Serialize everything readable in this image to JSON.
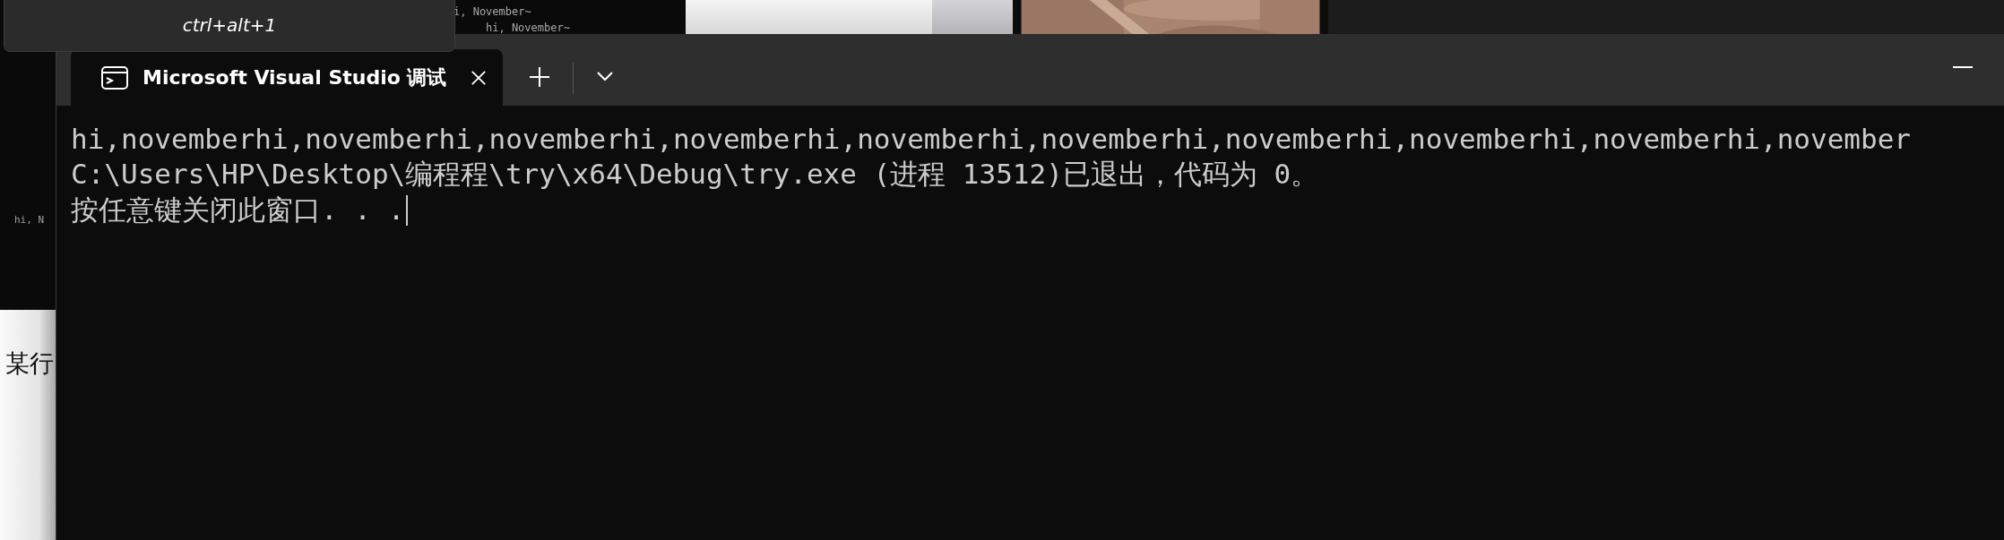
{
  "background": {
    "editor_lines": [
      "i, November~",
      "hi, November~"
    ],
    "side_text": "hi, N",
    "doc_text": "某行",
    "photo": {
      "kind": "picture"
    }
  },
  "tooltip": {
    "shortcut": "ctrl+alt+1"
  },
  "terminal": {
    "tabs": [
      {
        "title": "Microsoft Visual Studio 调试",
        "selected": true
      }
    ],
    "lines": [
      "hi,novemberhi,novemberhi,novemberhi,novemberhi,novemberhi,novemberhi,novemberhi,novemberhi,novemberhi,november",
      "C:\\Users\\HP\\Desktop\\编程程\\try\\x64\\Debug\\try.exe (进程 13512)已退出，代码为 0。",
      "按任意键关闭此窗口. . ."
    ],
    "cursor": true
  }
}
